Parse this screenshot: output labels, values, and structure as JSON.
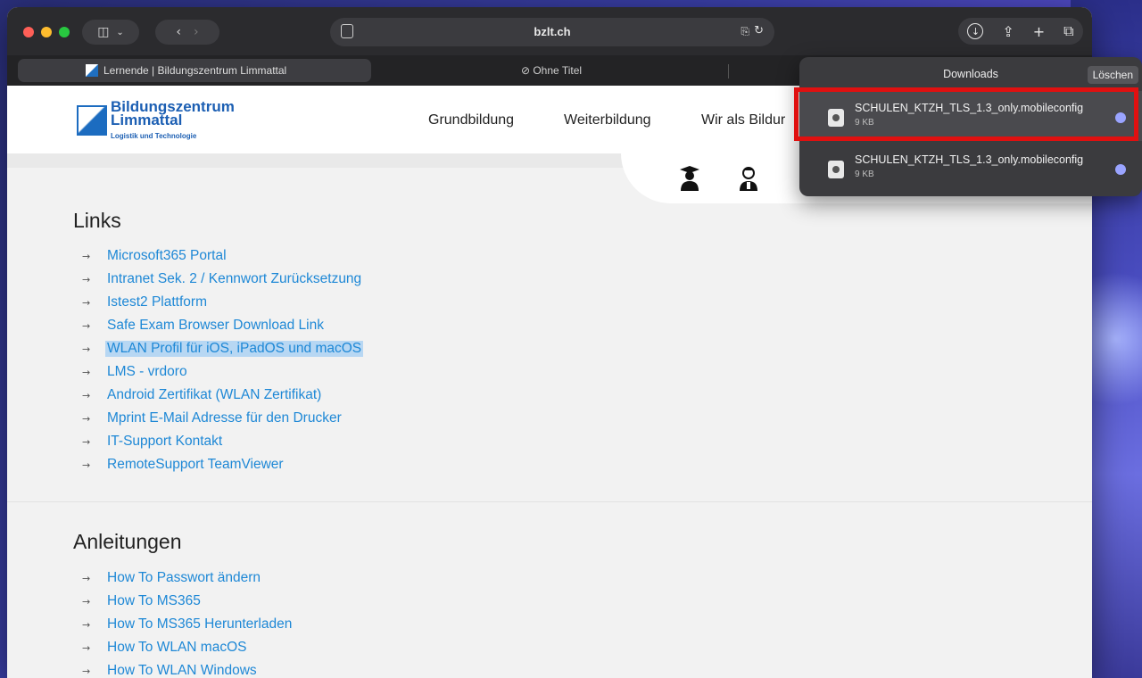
{
  "browser": {
    "url": "bzlt.ch",
    "tabs": [
      {
        "label": "Lernende | Bildungszentrum Limmattal",
        "active": true
      },
      {
        "label": "⊘ Ohne Titel",
        "active": false
      }
    ],
    "icons": [
      "sidebar-icon",
      "chevron-down-icon",
      "back-icon",
      "forward-icon",
      "page-icon",
      "reader-icon",
      "reload-icon",
      "download-icon",
      "share-icon",
      "new-tab-icon",
      "tab-overview-icon"
    ]
  },
  "site": {
    "logo_line1": "Bildungszentrum",
    "logo_line2": "Limmattal",
    "logo_tagline": "Logistik und Technologie",
    "nav": [
      "Grundbildung",
      "Weiterbildung",
      "Wir als Bildur"
    ]
  },
  "links_section": {
    "title": "Links",
    "items": [
      "Microsoft365 Portal",
      "Intranet Sek. 2 / Kennwort Zurücksetzung",
      "Istest2 Plattform",
      "Safe Exam Browser Download Link",
      "WLAN Profil für iOS, iPadOS und macOS",
      "LMS - vrdoro",
      "Android Zertifikat (WLAN Zertifikat)",
      "Mprint E-Mail Adresse für den Drucker",
      "IT-Support Kontakt",
      "RemoteSupport TeamViewer"
    ]
  },
  "guides_section": {
    "title": "Anleitungen",
    "items": [
      "How To Passwort ändern",
      "How To MS365",
      "How To MS365 Herunterladen",
      "How To WLAN macOS",
      "How To WLAN Windows"
    ]
  },
  "downloads": {
    "title": "Downloads",
    "clear_label": "Löschen",
    "items": [
      {
        "name": "SCHULEN_KTZH_TLS_1.3_only.mobileconfig",
        "size": "9 KB"
      },
      {
        "name": "SCHULEN_KTZH_TLS_1.3_only.mobileconfig",
        "size": "9 KB"
      }
    ]
  },
  "colors": {
    "link": "#1e88d6",
    "brand": "#1c5fb3",
    "highlight": "#e01010"
  }
}
